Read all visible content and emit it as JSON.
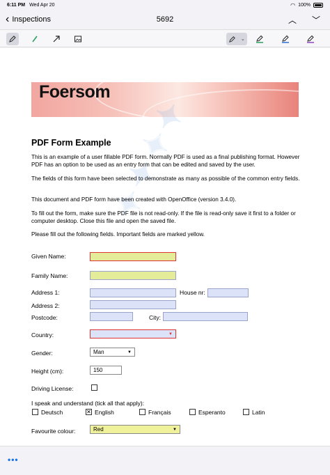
{
  "status": {
    "time": "6:11 PM",
    "date": "Wed Apr 20",
    "battery": "100%"
  },
  "nav": {
    "back_label": "Inspections",
    "title": "5692"
  },
  "document": {
    "banner_title": "Foersom",
    "heading": "PDF Form Example",
    "paragraphs": [
      "This is an example of a user fillable PDF form. Normally PDF is used as a final publishing format. However PDF has an option to be used as an entry form that can be edited and saved by the user.",
      "The fields of this form have been selected to demonstrate as many as possible of the common entry fields.",
      "This document and PDF form have been created with OpenOffice (version 3.4.0).",
      "To fill out the form, make sure the PDF file is not read-only. If the file is read-only save it first to a folder or computer desktop. Close this file and open the saved file.",
      "Please fill out the following fields. Important fields are marked yellow."
    ],
    "labels": {
      "given_name": "Given Name:",
      "family_name": "Family Name:",
      "address1": "Address 1:",
      "house_nr": "House nr:",
      "address2": "Address 2:",
      "postcode": "Postcode:",
      "city": "City:",
      "country": "Country:",
      "gender": "Gender:",
      "height": "Height (cm):",
      "driving_license": "Driving License:",
      "languages": "I speak and understand (tick all that apply):",
      "favourite_colour": "Favourite colour:"
    },
    "values": {
      "given_name": "",
      "family_name": "",
      "address1": "",
      "house_nr": "",
      "address2": "",
      "postcode": "",
      "city": "",
      "country": "",
      "gender": "Man",
      "height": "150",
      "favourite_colour": "Red"
    },
    "languages": [
      {
        "name": "Deutsch",
        "checked": false,
        "mark": ""
      },
      {
        "name": "English",
        "checked": true,
        "mark": "✕"
      },
      {
        "name": "Français",
        "checked": false,
        "mark": ""
      },
      {
        "name": "Esperanto",
        "checked": false,
        "mark": ""
      },
      {
        "name": "Latin",
        "checked": false,
        "mark": ""
      }
    ],
    "driving_license_checked": false
  },
  "icons": {
    "back": "chevron-left-icon",
    "up": "chevron-up-icon",
    "down": "chevron-down-icon",
    "more": "more-icon"
  },
  "colors": {
    "required_field": "#e4ec9a",
    "field": "#dce2f7",
    "accent": "#1a73e8"
  }
}
